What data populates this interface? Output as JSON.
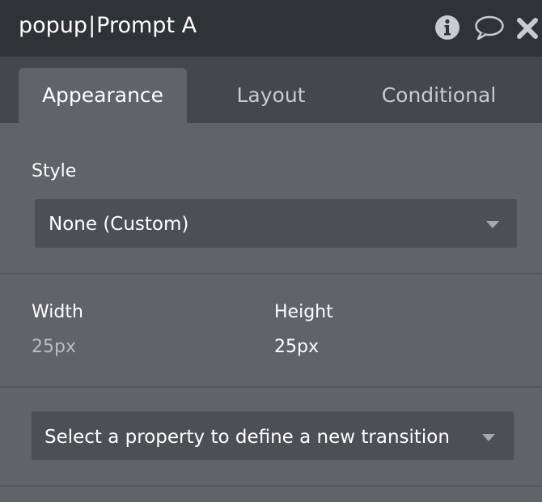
{
  "header": {
    "element_name": "popup",
    "separator": "|",
    "element_label": "Prompt A",
    "icons": [
      "info-icon",
      "comment-icon",
      "close-icon"
    ]
  },
  "tabs": [
    {
      "label": "Appearance",
      "active": true
    },
    {
      "label": "Layout",
      "active": false
    },
    {
      "label": "Conditional",
      "active": false
    }
  ],
  "style": {
    "label": "Style",
    "selected": "None (Custom)"
  },
  "dimensions": {
    "width_label": "Width",
    "width_value": "25px",
    "height_label": "Height",
    "height_value": "25px"
  },
  "transition": {
    "placeholder": "Select a property to define a new transition"
  },
  "colors": {
    "header_bg": "#2e3336",
    "tabbar_bg": "#43484c",
    "panel_bg": "#5f6468",
    "select_bg": "#4b5054",
    "muted_value": "#b9bcbf"
  }
}
